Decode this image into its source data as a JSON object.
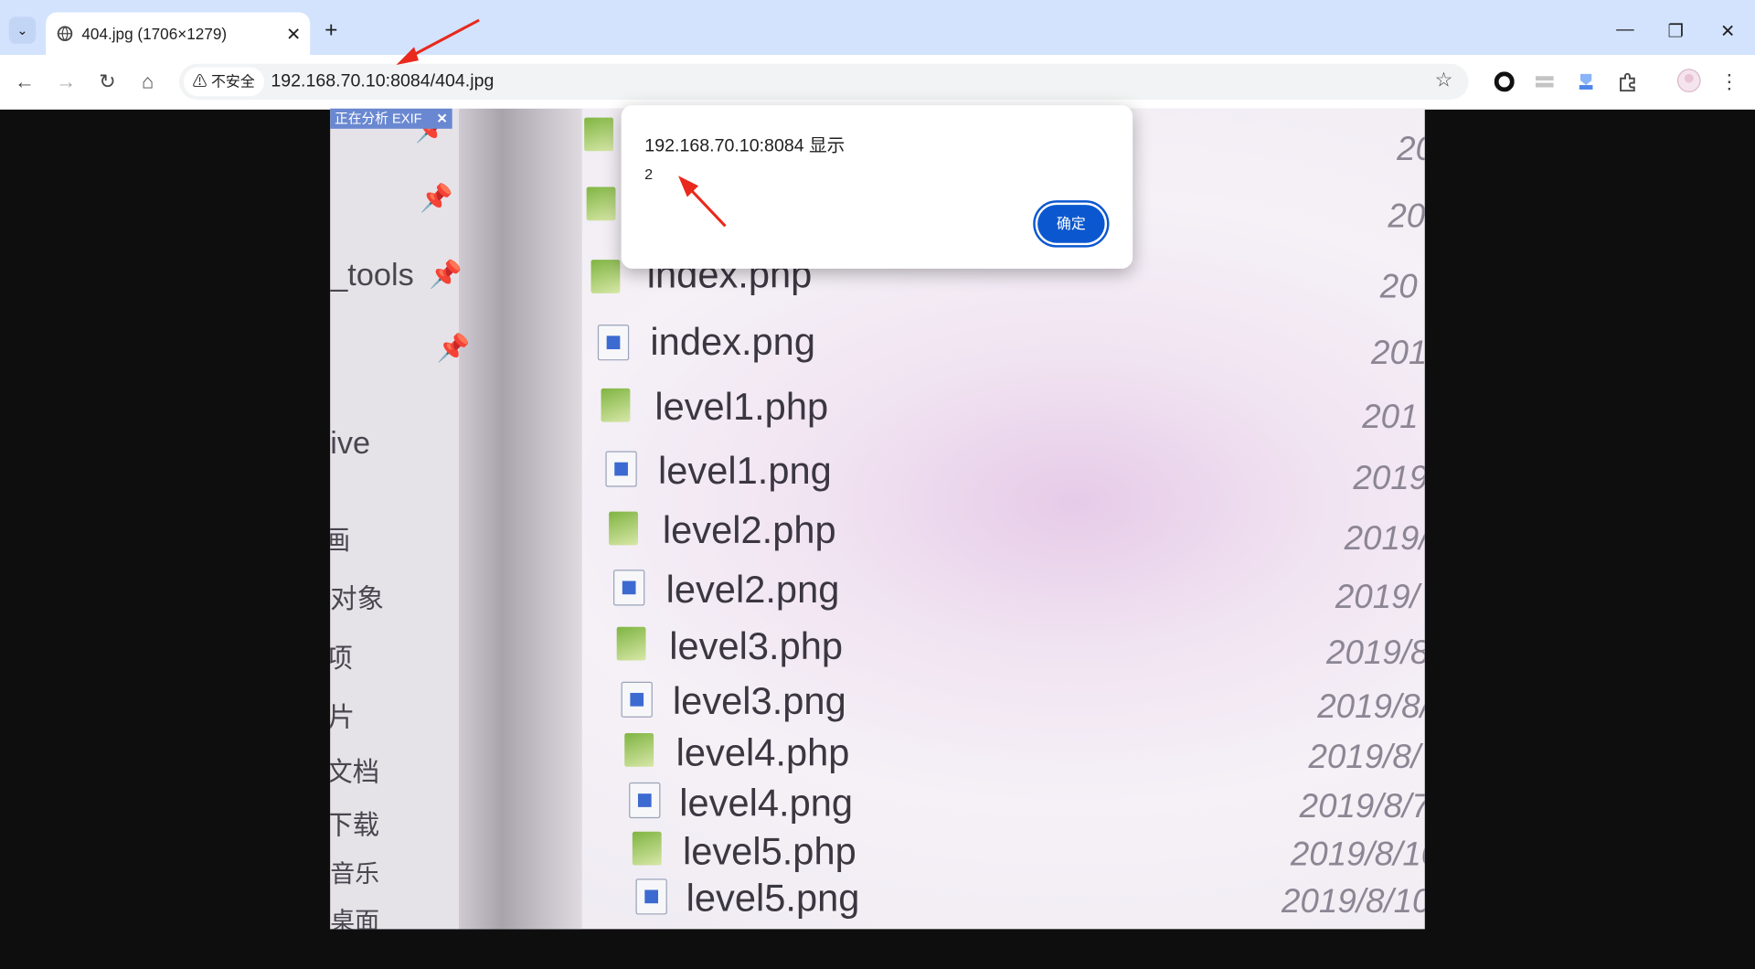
{
  "tab": {
    "title": "404.jpg (1706×1279)",
    "close": "✕",
    "list": "⌄",
    "new": "+"
  },
  "toolbar": {
    "back": "←",
    "forward": "→",
    "reload": "↻",
    "home": "⌂",
    "security": "不安全",
    "url": "192.168.70.10:8084/404.jpg",
    "bookmark": "☆"
  },
  "window_controls": {
    "minimize": "—",
    "maximize": "❐",
    "close": "✕"
  },
  "exif_badge": {
    "label": "正在分析 EXIF",
    "close": "✕"
  },
  "dialog": {
    "title": "192.168.70.10:8084 显示",
    "message": "2",
    "ok": "确定"
  },
  "photo": {
    "sidebar": [
      "_tools",
      "ive",
      "画",
      "对象",
      "项",
      "片",
      "文档",
      "下载",
      "音乐",
      "桌面"
    ],
    "files": [
      "index.php",
      "index.png",
      "level1.php",
      "level1.png",
      "level2.php",
      "level2.png",
      "level3.php",
      "level3.png",
      "level4.php",
      "level4.png",
      "level5.php",
      "level5.png"
    ],
    "dates": [
      "20",
      "20",
      "20",
      "201",
      "201",
      "2019",
      "2019/",
      "2019/",
      "2019/8",
      "2019/8/",
      "2019/8/",
      "2019/8/7",
      "2019/8/10",
      "2019/8/10"
    ]
  },
  "colors": {
    "accent": "#0b57d0",
    "tabstrip": "#d3e3fd",
    "annotation": "#e8291c"
  }
}
